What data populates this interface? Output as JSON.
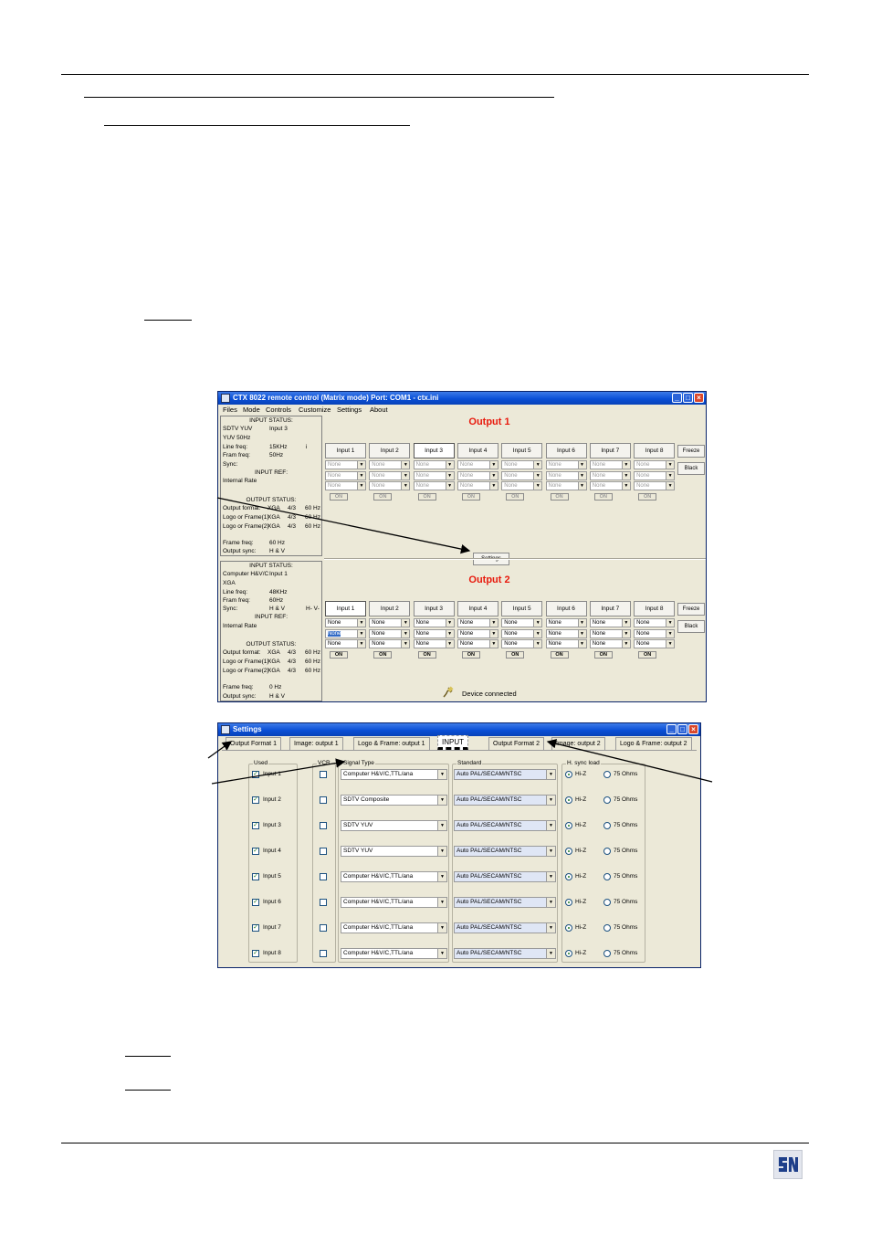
{
  "main_window": {
    "title": "CTX 8022 remote control     (Matrix mode)  Port: COM1 - ctx.ini",
    "menu": [
      "Files",
      "Mode",
      "Controls",
      "Customize",
      "Settings",
      "About"
    ],
    "output1_title": "Output 1",
    "output2_title": "Output 2",
    "input_buttons": [
      "Input 1",
      "Input 2",
      "Input 3",
      "Input 4",
      "Input 5",
      "Input 6",
      "Input 7",
      "Input 8"
    ],
    "combo_value": "None",
    "on_label": "ON",
    "freeze_label": "Freeze",
    "black_label": "Black",
    "settings_button": "Settings",
    "status_text": "Device connected",
    "status1": {
      "input_status_hdr": "INPUT STATUS:",
      "signal": "SDTV YUV",
      "signal_input": "Input 3",
      "format": "YUV 50Hz",
      "line_freq_lbl": "Line freq:",
      "line_freq": "15KHz",
      "line_freq_flag": "i",
      "fram_freq_lbl": "Fram freq:",
      "fram_freq": "50Hz",
      "sync_lbl": "Sync:",
      "sync": "",
      "input_ref_hdr": "INPUT REF:",
      "input_ref": "Internal Rate",
      "output_status_hdr": "OUTPUT STATUS:",
      "out_rows": [
        [
          "Output format:",
          "XGA",
          "4/3",
          "60 Hz"
        ],
        [
          "Logo or Frame(1)",
          "XGA",
          "4/3",
          "60 Hz"
        ],
        [
          "Logo or Frame(2)",
          "XGA",
          "4/3",
          "60 Hz"
        ]
      ],
      "frame_freq_lbl": "Frame freq:",
      "frame_freq": "60 Hz",
      "output_sync_lbl": "Output sync:",
      "output_sync": "H & V"
    },
    "status2": {
      "input_status_hdr": "INPUT STATUS:",
      "signal": "Computer H&V/C",
      "signal_input": "Input 1",
      "format": "XGA",
      "line_freq_lbl": "Line freq:",
      "line_freq": "48KHz",
      "fram_freq_lbl": "Fram freq:",
      "fram_freq": "60Hz",
      "sync_lbl": "Sync:",
      "sync": "H & V",
      "sync_pol": "H- V-",
      "input_ref_hdr": "INPUT REF:",
      "input_ref": "Internal Rate",
      "output_status_hdr": "OUTPUT STATUS:",
      "out_rows": [
        [
          "Output format:",
          "XGA",
          "4/3",
          "60 Hz"
        ],
        [
          "Logo or Frame(1)",
          "XGA",
          "4/3",
          "60 Hz"
        ],
        [
          "Logo or Frame(2)",
          "XGA",
          "4/3",
          "60 Hz"
        ]
      ],
      "frame_freq_lbl": "Frame freq:",
      "frame_freq": "0 Hz",
      "output_sync_lbl": "Output sync:",
      "output_sync": "H & V"
    }
  },
  "settings_window": {
    "title": "Settings",
    "tabs": [
      "Output Format 1",
      "Image: output 1",
      "Logo & Frame: output 1",
      "INPUT",
      "Output Format 2",
      "Image: output 2",
      "Logo & Frame: output 2"
    ],
    "selected_tab": "INPUT",
    "group_labels": {
      "used": "Used",
      "vcr": "VCR",
      "signal_type": "Signal Type",
      "standard": "Standard",
      "hsync": "H. sync load"
    },
    "radio_hiz": "Hi-Z",
    "radio_75": "75 Ohms",
    "rows": [
      {
        "input": "Input 1",
        "signal_type": "Computer H&V/C,TTL/ana",
        "standard": "Auto PAL/SECAM/NTSC"
      },
      {
        "input": "Input 2",
        "signal_type": "SDTV Composite",
        "standard": "Auto PAL/SECAM/NTSC"
      },
      {
        "input": "Input 3",
        "signal_type": "SDTV YUV",
        "standard": "Auto PAL/SECAM/NTSC"
      },
      {
        "input": "Input 4",
        "signal_type": "SDTV YUV",
        "standard": "Auto PAL/SECAM/NTSC"
      },
      {
        "input": "Input 5",
        "signal_type": "Computer H&V/C,TTL/ana",
        "standard": "Auto PAL/SECAM/NTSC"
      },
      {
        "input": "Input 6",
        "signal_type": "Computer H&V/C,TTL/ana",
        "standard": "Auto PAL/SECAM/NTSC"
      },
      {
        "input": "Input 7",
        "signal_type": "Computer H&V/C,TTL/ana",
        "standard": "Auto PAL/SECAM/NTSC"
      },
      {
        "input": "Input 8",
        "signal_type": "Computer H&V/C,TTL/ana",
        "standard": "Auto PAL/SECAM/NTSC"
      }
    ]
  }
}
